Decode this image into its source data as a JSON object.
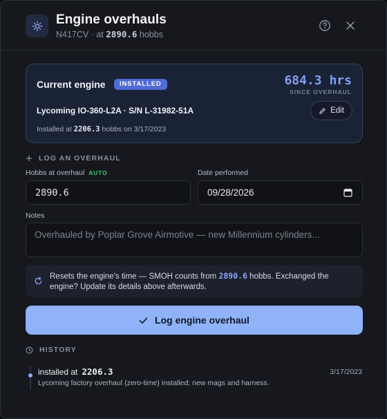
{
  "header": {
    "title": "Engine overhauls",
    "tail_number": "N417CV",
    "subtitle_sep": " · at ",
    "current_hobbs": "2890.6",
    "hobbs_unit": " hobbs",
    "icons": [
      "help-icon",
      "close-icon"
    ]
  },
  "current_engine": {
    "title": "Current engine",
    "badge": "INSTALLED",
    "smoh_value": "684.3 hrs",
    "smoh_label": "SINCE OVERHAUL",
    "model_line": "Lycoming IO-360-L2A · S/N L-31982-51A",
    "installed_prefix": "Installed at ",
    "installed_hobbs": "2206.3",
    "installed_suffix": " hobbs on 3/17/2023",
    "edit_label": "Edit"
  },
  "log_form": {
    "section_label": "LOG AN OVERHAUL",
    "hobbs_label": "Hobbs at overhaul",
    "hobbs_auto_tag": "AUTO",
    "hobbs_value": "2890.6",
    "date_label": "Date performed",
    "date_value": "09/28/2026",
    "notes_label": "Notes",
    "notes_placeholder": "Overhauled by Poplar Grove Airmotive — new Millennium cylinders...",
    "info_part1": "Resets the engine's time — SMOH counts from ",
    "info_hobbs": "2890.6",
    "info_part2": " hobbs. Exchanged the engine? Update its details above afterwards.",
    "submit_label": "Log engine overhaul"
  },
  "history": {
    "section_label": "HISTORY",
    "entries": [
      {
        "title": "installed at",
        "hobbs": "2206.3",
        "date": "3/17/2023",
        "note": "Lycoming factory overhaul (zero-time) installed; new mags and harness."
      }
    ]
  },
  "colors": {
    "accent": "#8fb2f8",
    "badge": "#4f6bd6",
    "auto_tag": "#3fcf73",
    "panel_bg": "#16181d"
  }
}
